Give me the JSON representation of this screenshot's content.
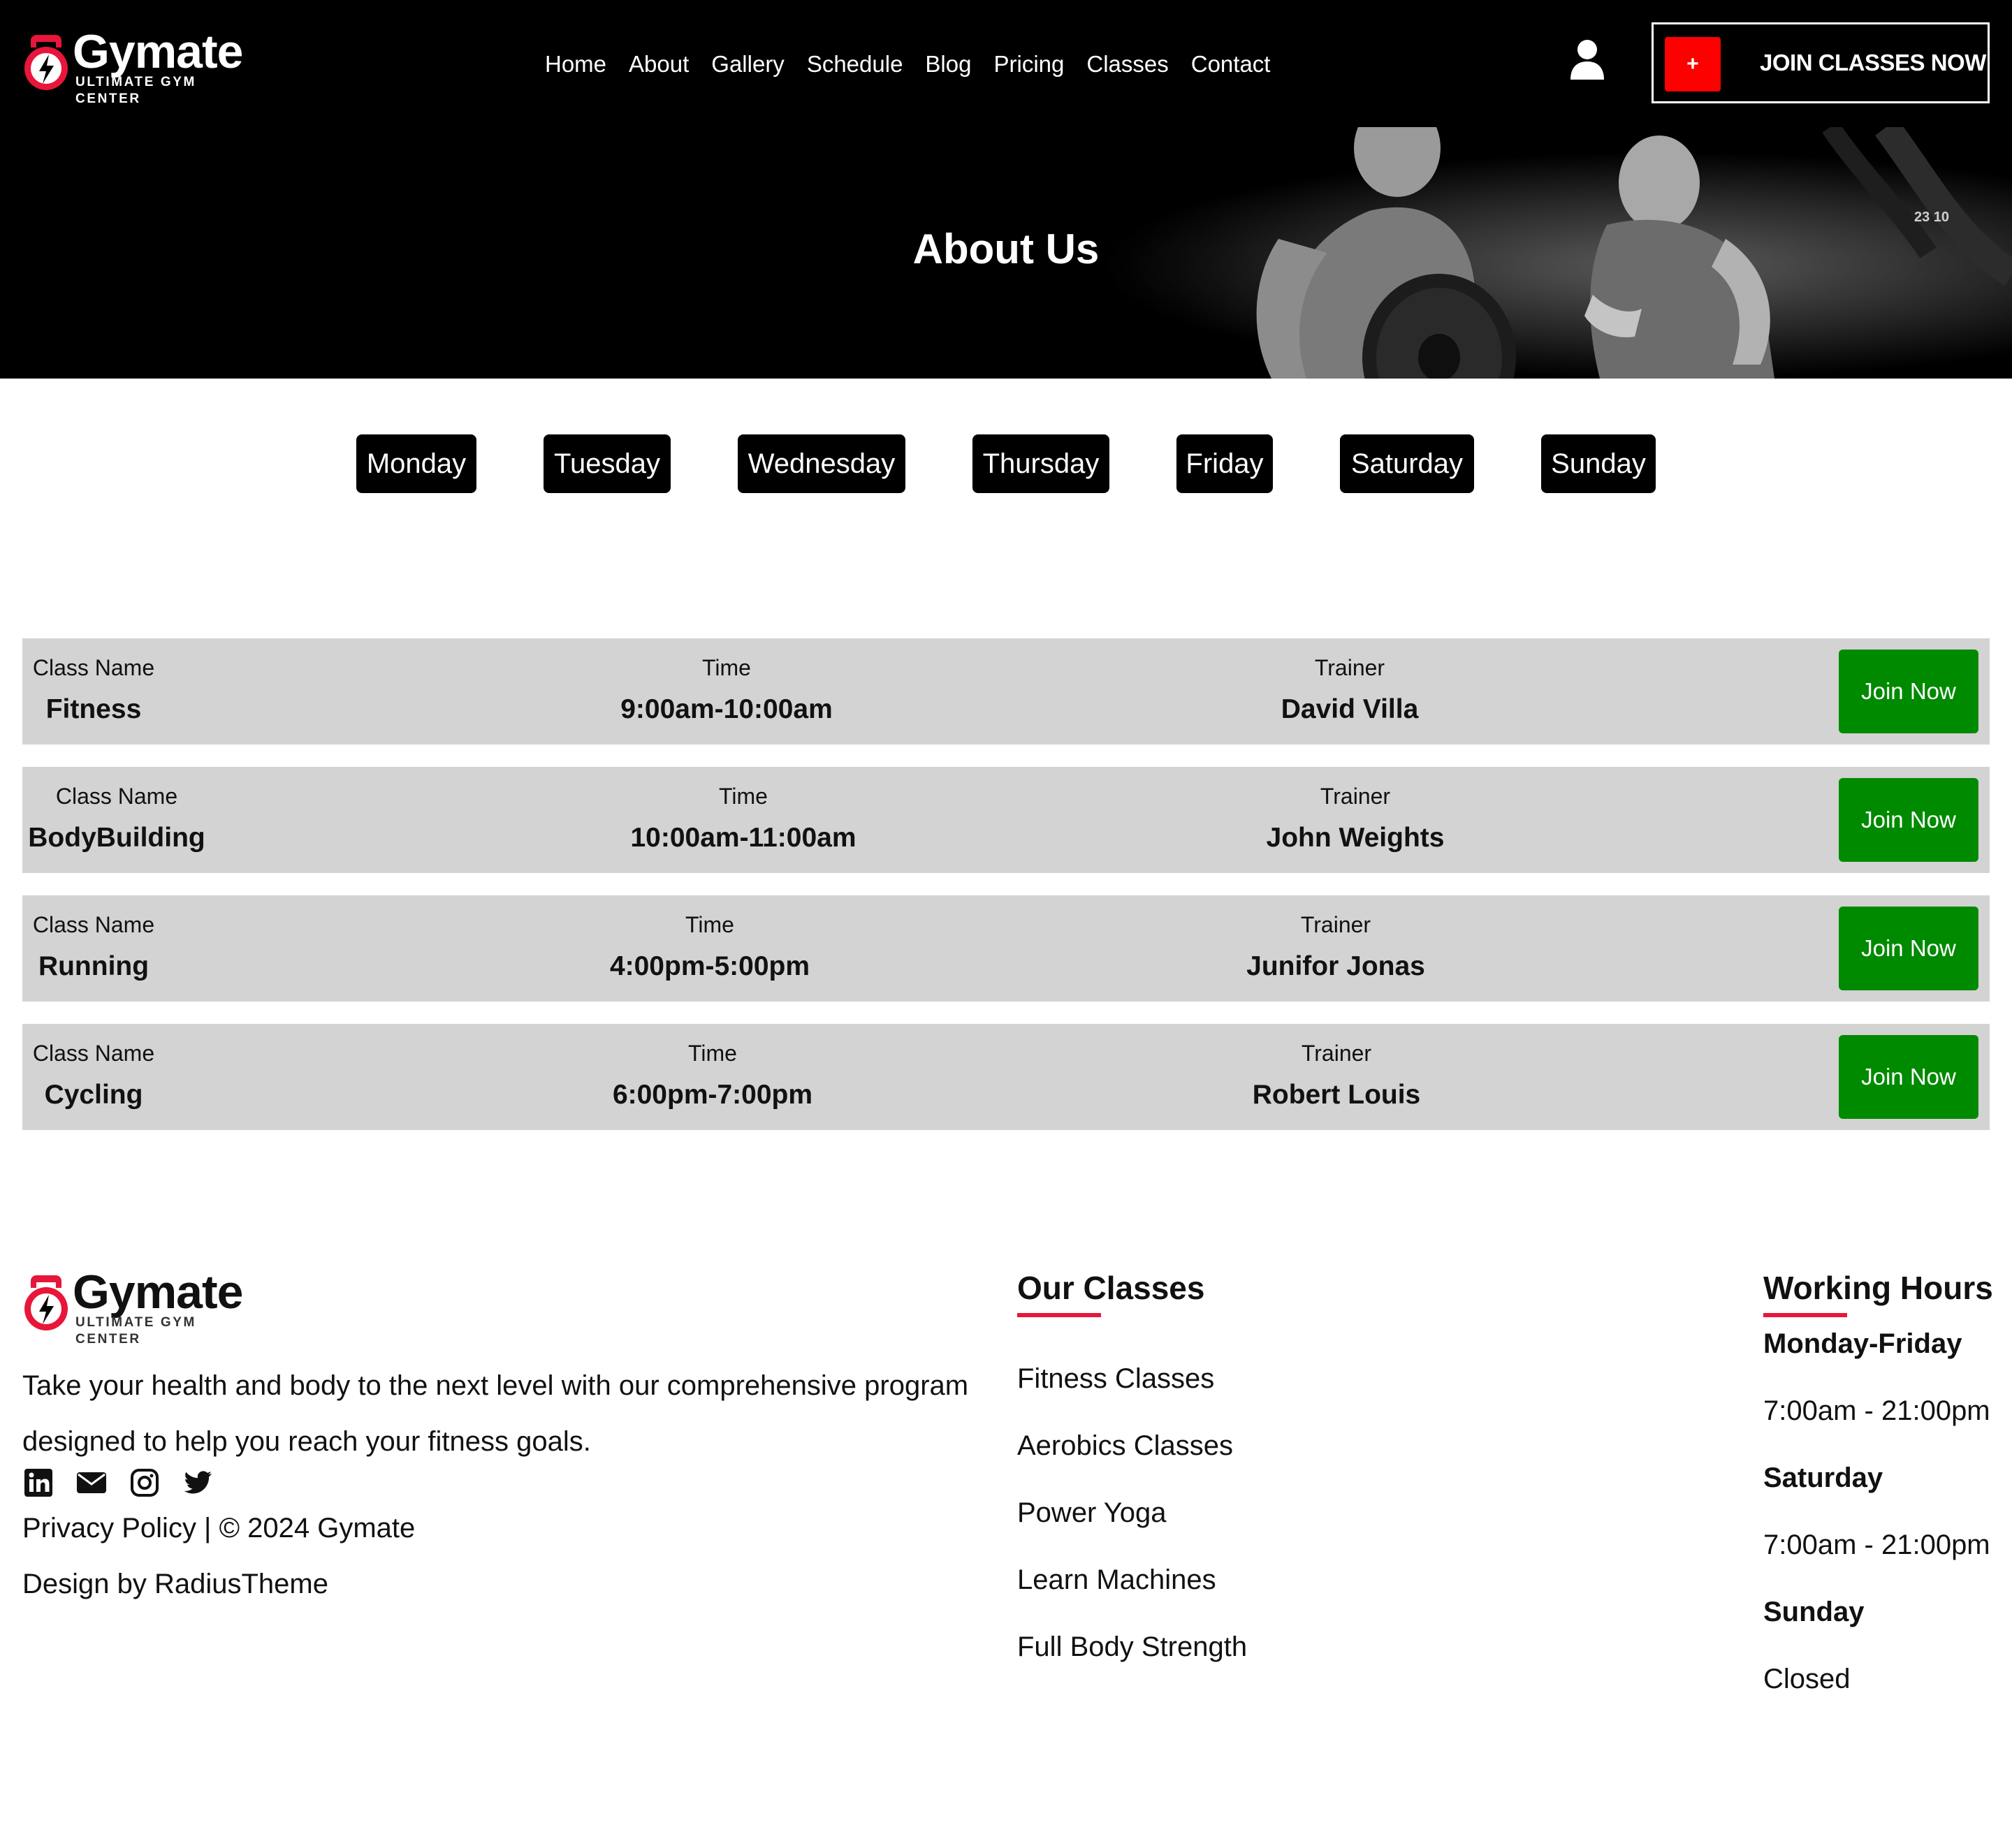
{
  "brand": {
    "name": "Gymate",
    "tagline": "ULTIMATE GYM CENTER"
  },
  "nav": [
    "Home",
    "About",
    "Gallery",
    "Schedule",
    "Blog",
    "Pricing",
    "Classes",
    "Contact"
  ],
  "header": {
    "join_plus": "+",
    "join_label": "JOIN CLASSES NOW"
  },
  "hero": {
    "title": "About Us",
    "timer_text": "23 10"
  },
  "days": [
    "Monday",
    "Tuesday",
    "Wednesday",
    "Thursday",
    "Friday",
    "Saturday",
    "Sunday"
  ],
  "schedule": {
    "labels": {
      "class": "Class Name",
      "time": "Time",
      "trainer": "Trainer"
    },
    "join_label": "Join Now",
    "rows": [
      {
        "class": "Fitness",
        "time": "9:00am-10:00am",
        "trainer": "David Villa"
      },
      {
        "class": "BodyBuilding",
        "time": "10:00am-11:00am",
        "trainer": "John Weights"
      },
      {
        "class": "Running",
        "time": "4:00pm-5:00pm",
        "trainer": "Junifor Jonas"
      },
      {
        "class": "Cycling",
        "time": "6:00pm-7:00pm",
        "trainer": "Robert Louis"
      }
    ]
  },
  "footer": {
    "about_line1": "Take your health and body to the next level with our comprehensive program",
    "about_line2": "designed to help you reach your fitness goals.",
    "socials": [
      "linkedin-icon",
      "email-icon",
      "instagram-icon",
      "twitter-icon"
    ],
    "copyright": "Privacy Policy | © 2024 Gymate",
    "credit": "Design by RadiusTheme",
    "classes_title": "Our Classes",
    "classes": [
      "Fitness Classes",
      "Aerobics Classes",
      "Power Yoga",
      "Learn Machines",
      "Full Body Strength"
    ],
    "hours_title": "Working Hours",
    "hours": [
      {
        "day": "Monday-Friday",
        "time": "7:00am - 21:00pm"
      },
      {
        "day": "Saturday",
        "time": "7:00am - 21:00pm"
      },
      {
        "day": "Sunday",
        "time": "Closed"
      }
    ]
  },
  "colors": {
    "accent_red": "#e8163a",
    "cta_red": "#ff0000",
    "join_green": "#008a00",
    "row_gray": "#d3d3d3"
  }
}
